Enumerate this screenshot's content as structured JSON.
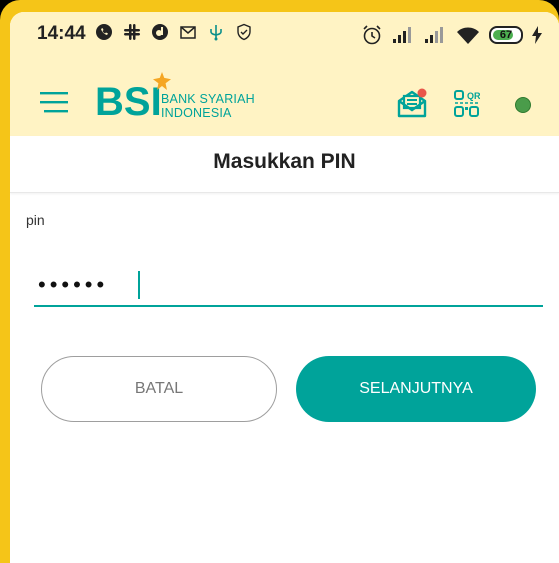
{
  "status_bar": {
    "time": "14:44",
    "battery_level": "67",
    "left_icons": [
      "whatsapp-icon",
      "slack-icon",
      "dana-icon",
      "gmail-icon",
      "usb-icon",
      "shield-icon"
    ],
    "right_icons": [
      "alarm-icon",
      "signal-icon",
      "signal-icon",
      "wifi-icon",
      "battery-icon",
      "charging-icon"
    ]
  },
  "app_bar": {
    "logo_text": "BSI",
    "logo_sub_line1": "BANK SYARIAH",
    "logo_sub_line2": "INDONESIA",
    "brand_color": "#00a39a",
    "accent_color": "#f5a623"
  },
  "page": {
    "title": "Masukkan PIN"
  },
  "form": {
    "pin_label": "pin",
    "pin_value_masked": "••••••"
  },
  "buttons": {
    "cancel_label": "BATAL",
    "next_label": "SELANJUTNYA"
  }
}
